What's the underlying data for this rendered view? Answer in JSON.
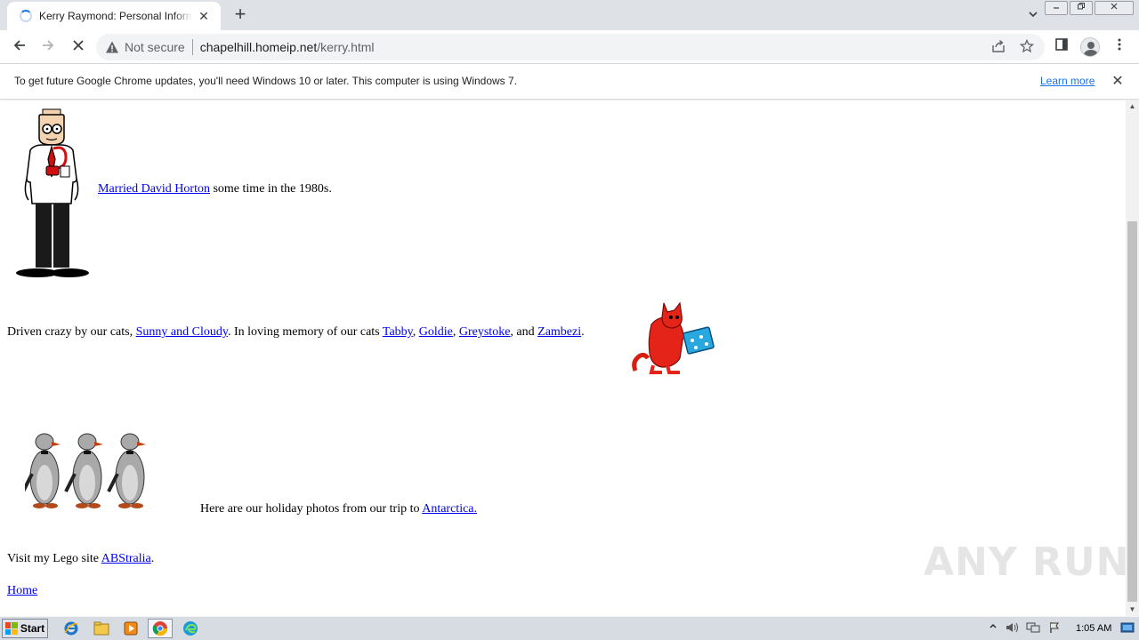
{
  "browser": {
    "tab_title": "Kerry Raymond: Personal Information",
    "tab_close": "✕",
    "new_tab": "+",
    "not_secure": "Not secure",
    "url_host": "chapelhill.homeip.net",
    "url_path": "/kerry.html"
  },
  "infobar": {
    "message": "To get future Google Chrome updates, you'll need Windows 10 or later. This computer is using Windows 7.",
    "learn_more": "Learn more",
    "close": "✕"
  },
  "page": {
    "married": {
      "link": "Married David Horton",
      "text": " some time in the 1980s."
    },
    "cats": {
      "prefix": "Driven crazy by our cats, ",
      "current_cats_link": "Sunny and Cloudy",
      "middle": ". In loving memory of our cats ",
      "cat1": "Tabby",
      "sep1": ", ",
      "cat2": "Goldie",
      "sep2": ", ",
      "cat3": "Greystoke",
      "sep3": ", and ",
      "cat4": "Zambezi",
      "suffix": "."
    },
    "holiday": {
      "text": "Here are our holiday photos from our trip to ",
      "link": "Antarctica."
    },
    "lego": {
      "text": "Visit my Lego site ",
      "link": "ABStralia",
      "suffix": "."
    },
    "home_link": "Home"
  },
  "watermark": "ANY RUN",
  "taskbar": {
    "start_label": "Start",
    "clock": "1:05 AM"
  }
}
